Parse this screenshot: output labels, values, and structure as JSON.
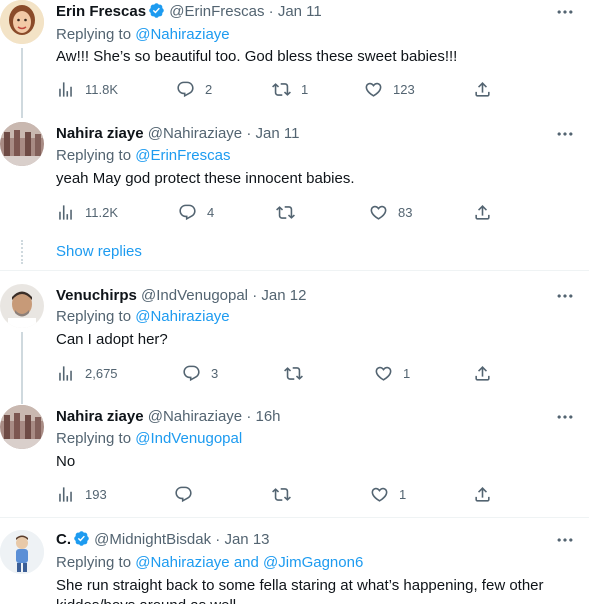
{
  "tweets": [
    {
      "name": "Erin Frescas",
      "verified": true,
      "handle": "@ErinFrescas",
      "dot": "·",
      "date": "Jan 11",
      "replying_label": "Replying to",
      "mention": "@Nahiraziaye",
      "text": "Aw!!! She’s so beautiful too. God bless these sweet babies!!!",
      "views": "11.8K",
      "replies": "2",
      "retweets": "1",
      "likes": "123"
    },
    {
      "name": "Nahira ziaye",
      "verified": false,
      "handle": "@Nahiraziaye",
      "dot": "·",
      "date": "Jan 11",
      "replying_label": "Replying to",
      "mention": "@ErinFrescas",
      "text": "yeah May god protect these innocent babies.",
      "views": "11.2K",
      "replies": "4",
      "retweets": "",
      "likes": "83"
    },
    {
      "name": "Venuchirps",
      "verified": false,
      "handle": "@IndVenugopal",
      "dot": "·",
      "date": "Jan 12",
      "replying_label": "Replying to",
      "mention": "@Nahiraziaye",
      "text": "Can I adopt her?",
      "views": "2,675",
      "replies": "3",
      "retweets": "",
      "likes": "1"
    },
    {
      "name": "Nahira ziaye",
      "verified": false,
      "handle": "@Nahiraziaye",
      "dot": "·",
      "date": "16h",
      "replying_label": "Replying to",
      "mention": "@IndVenugopal",
      "text": "No",
      "views": "193",
      "replies": "",
      "retweets": "",
      "likes": "1"
    },
    {
      "name": "C.",
      "verified": true,
      "handle": "@MidnightBisdak",
      "dot": "·",
      "date": "Jan 13",
      "replying_label": "Replying to",
      "mention": "@Nahiraziaye and @JimGagnon6",
      "text": "She run straight back to some fella staring at what’s happening, few other",
      "text2": "kiddos/boys around as well",
      "views": "",
      "replies": "",
      "retweets": "",
      "likes": ""
    }
  ],
  "show_replies": "Show replies",
  "colors": {
    "accent": "#1d9bf0",
    "muted": "#536471",
    "text": "#0f1419",
    "line": "#cfd9de"
  },
  "icons": [
    "more-icon",
    "views-icon",
    "reply-icon",
    "retweet-icon",
    "like-icon",
    "share-icon",
    "verified-icon"
  ]
}
